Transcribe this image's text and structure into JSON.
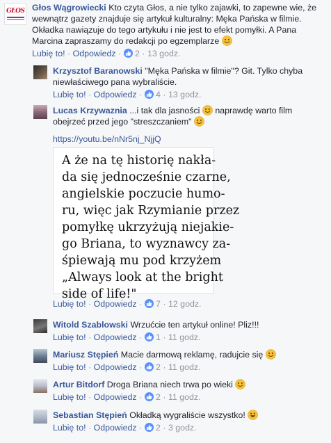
{
  "comments": [
    {
      "name": "Głos Wągrowiecki",
      "text": "Kto czyta Głos, a nie tylko zajawki, to zapewne wie, że wewnątrz gazety znajduje się artykuł kulturalny: Męka Pańska w filmie. Okładka nawiązuje do tego artykułu i nie jest to efekt pomyłki. A Pana Marcina zapraszamy do redakcji po egzemplarze",
      "like": "Lubię to!",
      "reply": "Odpowiedz",
      "reactions": "2",
      "time": "13 godz.",
      "avatar_text": "GŁOS"
    },
    {
      "name": "Krzysztof Baranowski",
      "text": "\"Męka Pańska w filmie\"? Git. Tylko chyba niewłaściwego pana wybraliście.",
      "like": "Lubię to!",
      "reply": "Odpowiedz",
      "reactions": "4",
      "time": "13 godz."
    },
    {
      "name": "Lucas Krzywaznia",
      "text_a": "...i tak dla jasności",
      "text_b": "naprawdę warto film obejrzeć przed jego \"streszczaniem\"",
      "link": "https://youtu.be/nNr5nj_NjjQ",
      "book_lines": [
        "A że na tę historię nakła-",
        "da się jednocześnie czarne,",
        "angielskie poczucie humo-",
        "ru, więc jak Rzymianie przez",
        "pomyłkę ukrzyżują niejakie-",
        "go Briana, to wyznawcy za-",
        "śpiewają mu pod krzyżem",
        "„Always look at the bright",
        "side of life!\""
      ],
      "like": "Lubię to!",
      "reply": "Odpowiedz",
      "reactions": "7",
      "time": "12 godz."
    },
    {
      "name": "Witold Szablowski",
      "text": "Wrzućcie ten artykuł online! Pliz!!!",
      "like": "Lubię to!",
      "reply": "Odpowiedz",
      "reactions": "1",
      "time": "11 godz."
    },
    {
      "name": "Mariusz Stępień",
      "text": "Macie darmową reklamę, radujcie się",
      "like": "Lubię to!",
      "reply": "Odpowiedz",
      "reactions": "2",
      "time": "11 godz."
    },
    {
      "name": "Artur Bitdorf",
      "text": "Droga Briana niech trwa po wieki",
      "like": "Lubię to!",
      "reply": "Odpowiedz",
      "reactions": "2",
      "time": "11 godz."
    },
    {
      "name": "Sebastian Stępień",
      "text": "Okładką wygraliście wszystko!",
      "like": "Lubię to!",
      "reply": "Odpowiedz",
      "reactions": "2",
      "time": "3 godz."
    }
  ],
  "colors": {
    "name": "#385898",
    "meta": "#90949c",
    "reaction": "#5890ff",
    "emoji": "#f7c23b"
  }
}
